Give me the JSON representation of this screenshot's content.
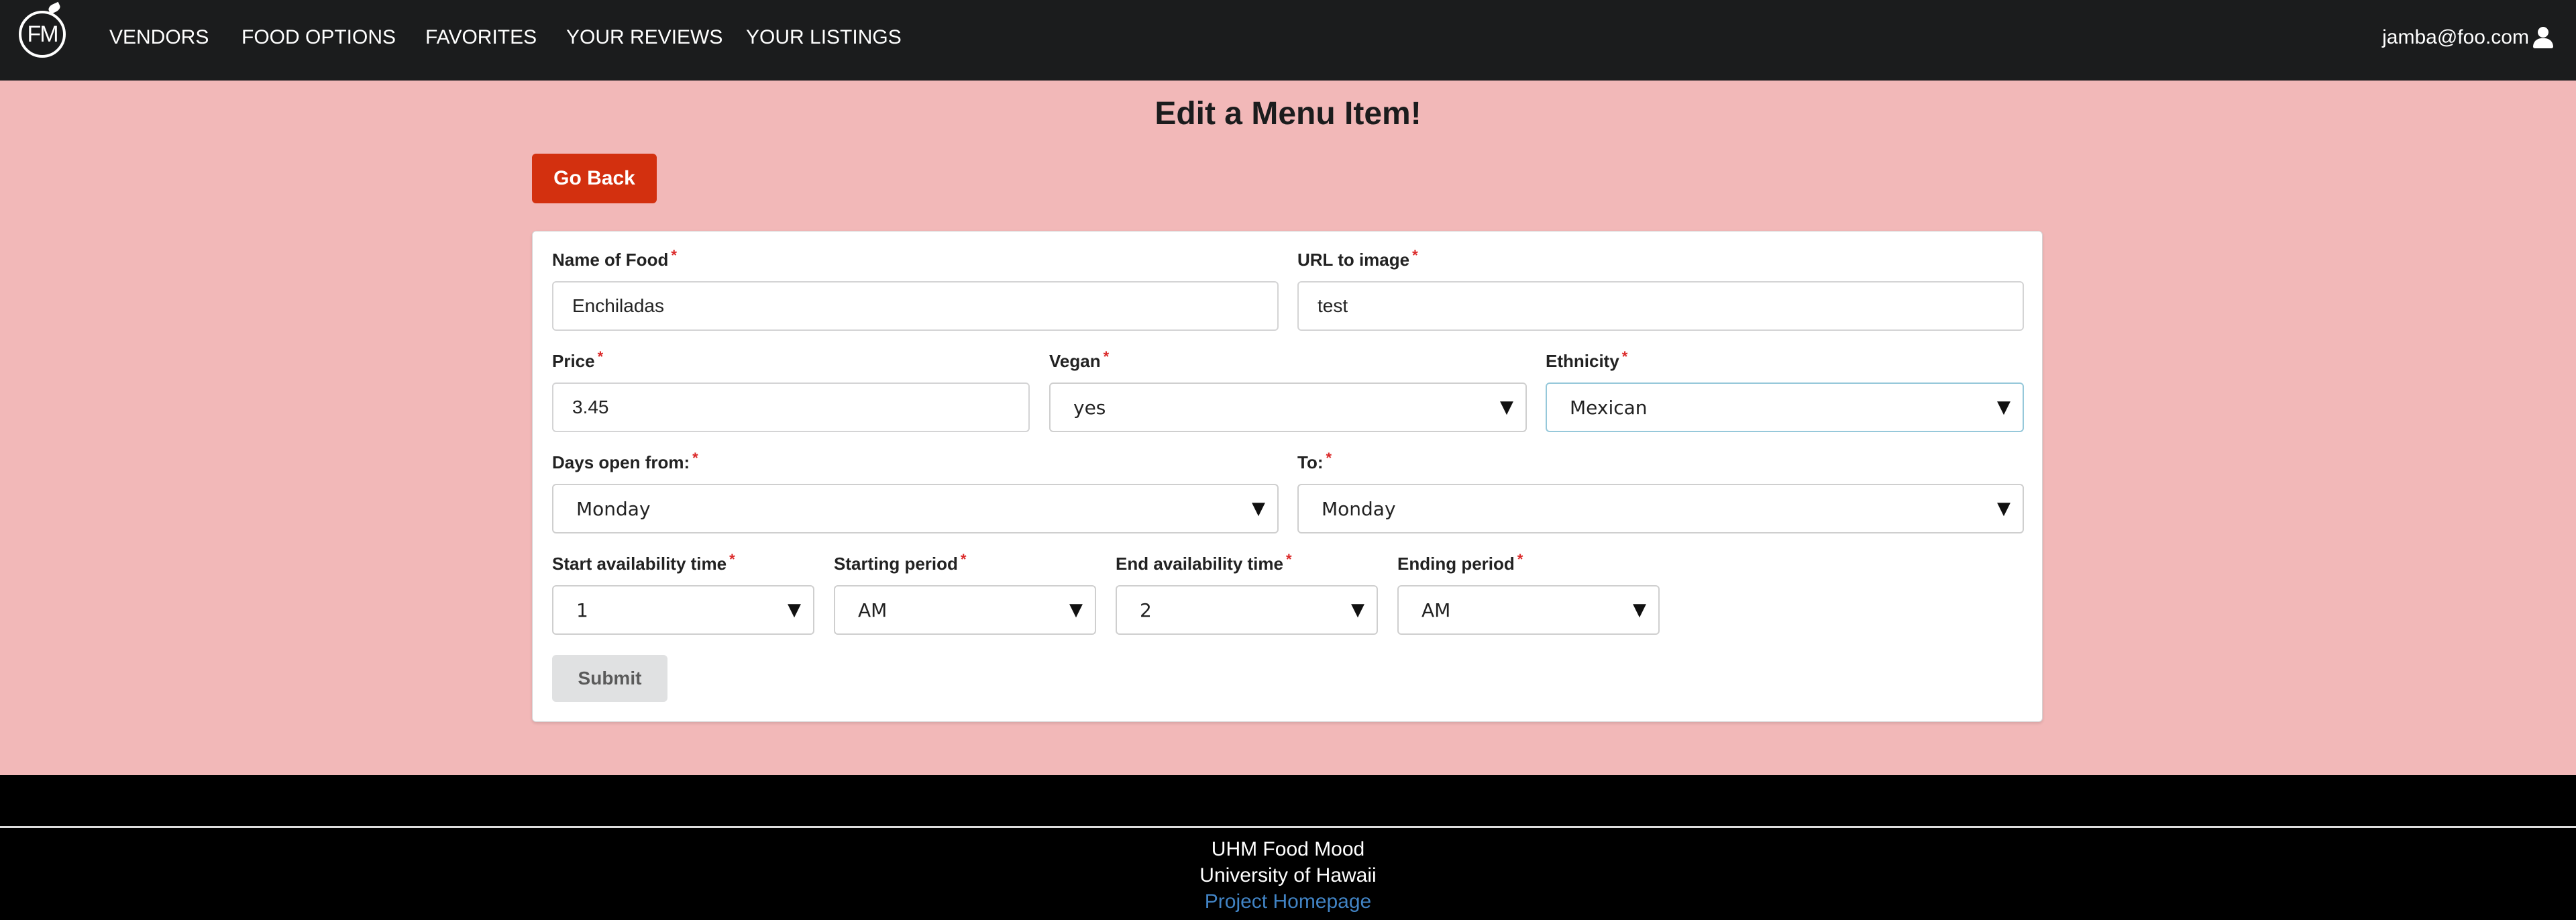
{
  "nav": {
    "logo_text": "FM",
    "items": [
      "VENDORS",
      "FOOD OPTIONS",
      "FAVORITES",
      "YOUR REVIEWS",
      "YOUR LISTINGS"
    ],
    "user_email": "jamba@foo.com",
    "user_icon": "user-icon"
  },
  "page": {
    "title": "Edit a Menu Item!",
    "go_back_label": "Go Back"
  },
  "form": {
    "required_marker": "*",
    "name_label": "Name of Food",
    "name_value": "Enchiladas",
    "url_label": "URL to image",
    "url_value": "test",
    "price_label": "Price",
    "price_value": "3.45",
    "vegan_label": "Vegan",
    "vegan_value": "yes",
    "ethnicity_label": "Ethnicity",
    "ethnicity_value": "Mexican",
    "days_from_label": "Days open from:",
    "days_from_value": "Monday",
    "days_to_label": "To:",
    "days_to_value": "Monday",
    "start_time_label": "Start availability time",
    "start_time_value": "1",
    "start_period_label": "Starting period",
    "start_period_value": "AM",
    "end_time_label": "End availability time",
    "end_time_value": "2",
    "end_period_label": "Ending period",
    "end_period_value": "AM",
    "submit_label": "Submit"
  },
  "footer": {
    "line1": "UHM Food Mood",
    "line2": "University of Hawaii",
    "link": "Project Homepage"
  },
  "colors": {
    "background": "#f2b8b8",
    "navbar": "#1b1c1d",
    "go_back_button": "#d3300f",
    "required_marker": "#db2828",
    "footer_link": "#4183c4"
  }
}
